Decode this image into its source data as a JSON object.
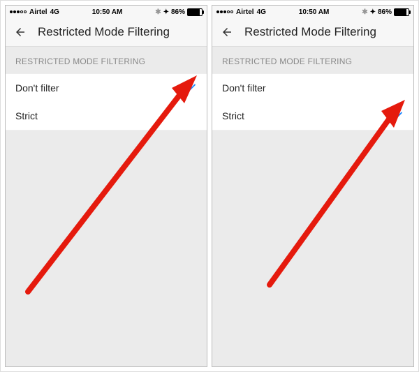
{
  "screens": [
    {
      "statusbar": {
        "carrier": "Airtel",
        "network": "4G",
        "time": "10:50 AM",
        "battery_percent": "86%"
      },
      "nav": {
        "title": "Restricted Mode Filtering"
      },
      "section_header": "RESTRICTED MODE FILTERING",
      "options": [
        {
          "label": "Don't filter",
          "selected": true
        },
        {
          "label": "Strict",
          "selected": false
        }
      ]
    },
    {
      "statusbar": {
        "carrier": "Airtel",
        "network": "4G",
        "time": "10:50 AM",
        "battery_percent": "86%"
      },
      "nav": {
        "title": "Restricted Mode Filtering"
      },
      "section_header": "RESTRICTED MODE FILTERING",
      "options": [
        {
          "label": "Don't filter",
          "selected": false
        },
        {
          "label": "Strict",
          "selected": true
        }
      ]
    }
  ],
  "icons": {
    "back": "back-arrow-icon",
    "check": "checkmark-icon",
    "annotation": "red-arrow-annotation"
  },
  "colors": {
    "check": "#1e88ff",
    "arrow": "#e51a0d"
  }
}
